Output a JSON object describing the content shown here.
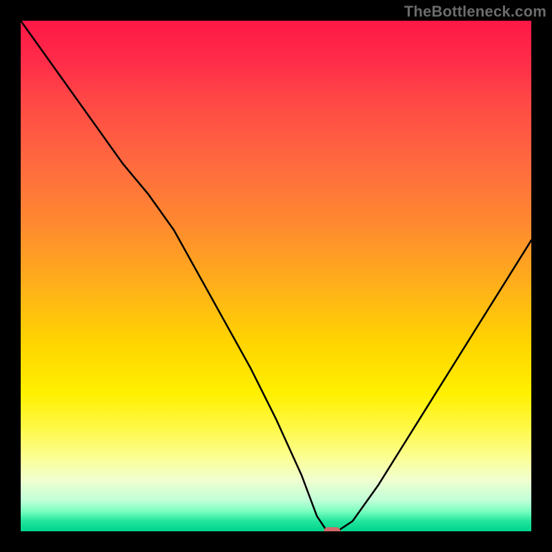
{
  "watermark": "TheBottleneck.com",
  "chart_data": {
    "type": "line",
    "title": "",
    "xlabel": "",
    "ylabel": "",
    "xlim": [
      0,
      100
    ],
    "ylim": [
      0,
      100
    ],
    "grid": false,
    "legend": null,
    "series": [
      {
        "name": "bottleneck-curve",
        "x": [
          0,
          5,
          10,
          15,
          20,
          25,
          30,
          35,
          40,
          45,
          50,
          55,
          58,
          60,
          62,
          65,
          70,
          75,
          80,
          85,
          90,
          95,
          100
        ],
        "y": [
          100,
          93,
          86,
          79,
          72,
          66,
          59,
          50,
          41,
          32,
          22,
          11,
          3,
          0,
          0,
          2,
          9,
          17,
          25,
          33,
          41,
          49,
          57
        ]
      }
    ],
    "marker": {
      "name": "optimal-point",
      "x": 61,
      "y": 0,
      "color": "#d06a6a"
    },
    "background_gradient": {
      "top": "#ff1846",
      "mid": "#ffd400",
      "bottom": "#00d48b"
    }
  }
}
